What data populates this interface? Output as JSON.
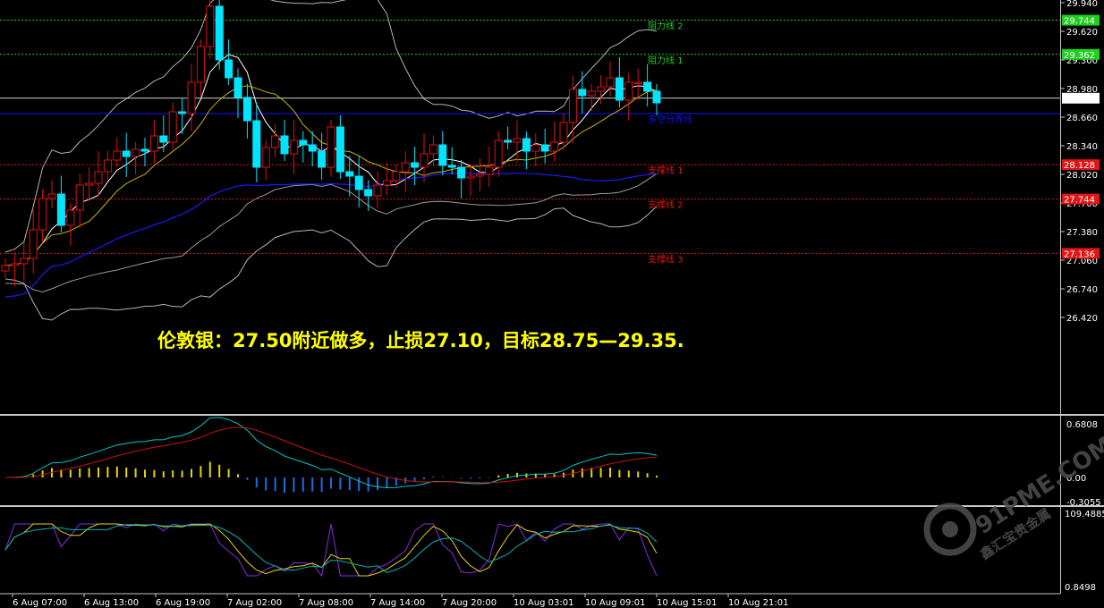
{
  "headline": "伦敦银：27.50附近做多，止损27.10，目标28.75—29.35.",
  "watermark": {
    "brand": "91PME.COM",
    "cn": "鑫汇宝贵金属"
  },
  "colors": {
    "background": "#000000",
    "bull_body": "#000000",
    "bull_wick": "#dd1010",
    "bear_body": "#00e5ff",
    "bear_wick": "#00e5ff",
    "resistance": "#1fd01f",
    "support": "#e01515",
    "long_short": "#1010ff",
    "macd_pos": "#e6d500",
    "macd_neg": "#1a6ee6"
  },
  "chart_data": {
    "type": "candlestick",
    "price_axis": {
      "min": 26.32,
      "max": 29.94,
      "ticks": [
        "29.940",
        "29.620",
        "29.300",
        "28.980",
        "28.660",
        "28.340",
        "28.020",
        "27.700",
        "27.380",
        "27.060",
        "26.740",
        "26.420"
      ]
    },
    "current_price": "28.872",
    "levels": [
      {
        "name": "阻力线 2",
        "value": "29.744",
        "kind": "resistance"
      },
      {
        "name": "阻力线 1",
        "value": "29.362",
        "kind": "resistance"
      },
      {
        "name": "多空分界线",
        "value": "28.7",
        "kind": "long_short"
      },
      {
        "name": "支撑线 1",
        "value": "28.128",
        "kind": "support"
      },
      {
        "name": "支撑线 2",
        "value": "27.744",
        "kind": "support"
      },
      {
        "name": "支撑线 3",
        "value": "27.136",
        "kind": "support"
      }
    ],
    "time_labels": [
      "6 Aug 07:00",
      "6 Aug 13:00",
      "6 Aug 19:00",
      "7 Aug 02:00",
      "7 Aug 08:00",
      "7 Aug 14:00",
      "7 Aug 20:00",
      "10 Aug 03:01",
      "10 Aug 09:01",
      "10 Aug 15:01",
      "10 Aug 21:01"
    ],
    "candles_close": [
      27.0,
      27.02,
      27.08,
      27.4,
      27.75,
      27.8,
      27.45,
      27.62,
      27.9,
      27.92,
      28.05,
      28.18,
      28.28,
      28.22,
      28.3,
      28.28,
      28.45,
      28.38,
      28.72,
      28.7,
      29.05,
      29.45,
      29.9,
      29.3,
      29.1,
      28.88,
      28.62,
      28.1,
      28.32,
      28.45,
      28.25,
      28.4,
      28.35,
      28.28,
      28.1,
      28.55,
      28.05,
      28.0,
      27.85,
      27.78,
      27.9,
      27.95,
      28.05,
      28.15,
      28.1,
      28.25,
      28.35,
      28.12,
      28.1,
      27.98,
      28.0,
      28.02,
      28.1,
      28.4,
      28.38,
      28.42,
      28.28,
      28.35,
      28.28,
      28.38,
      28.6,
      28.97,
      28.9,
      28.95,
      29.0,
      29.1,
      28.85,
      29.05,
      29.05,
      28.95,
      28.82
    ],
    "series_names": [],
    "macd_axis": {
      "max_label": "0.6808",
      "zero_label": "0.00",
      "min_label": "-0.3055",
      "max": 0.6808,
      "min": -0.3055
    },
    "osc_axis": {
      "max_label": "109.4885",
      "min_label": "0.8498"
    }
  }
}
